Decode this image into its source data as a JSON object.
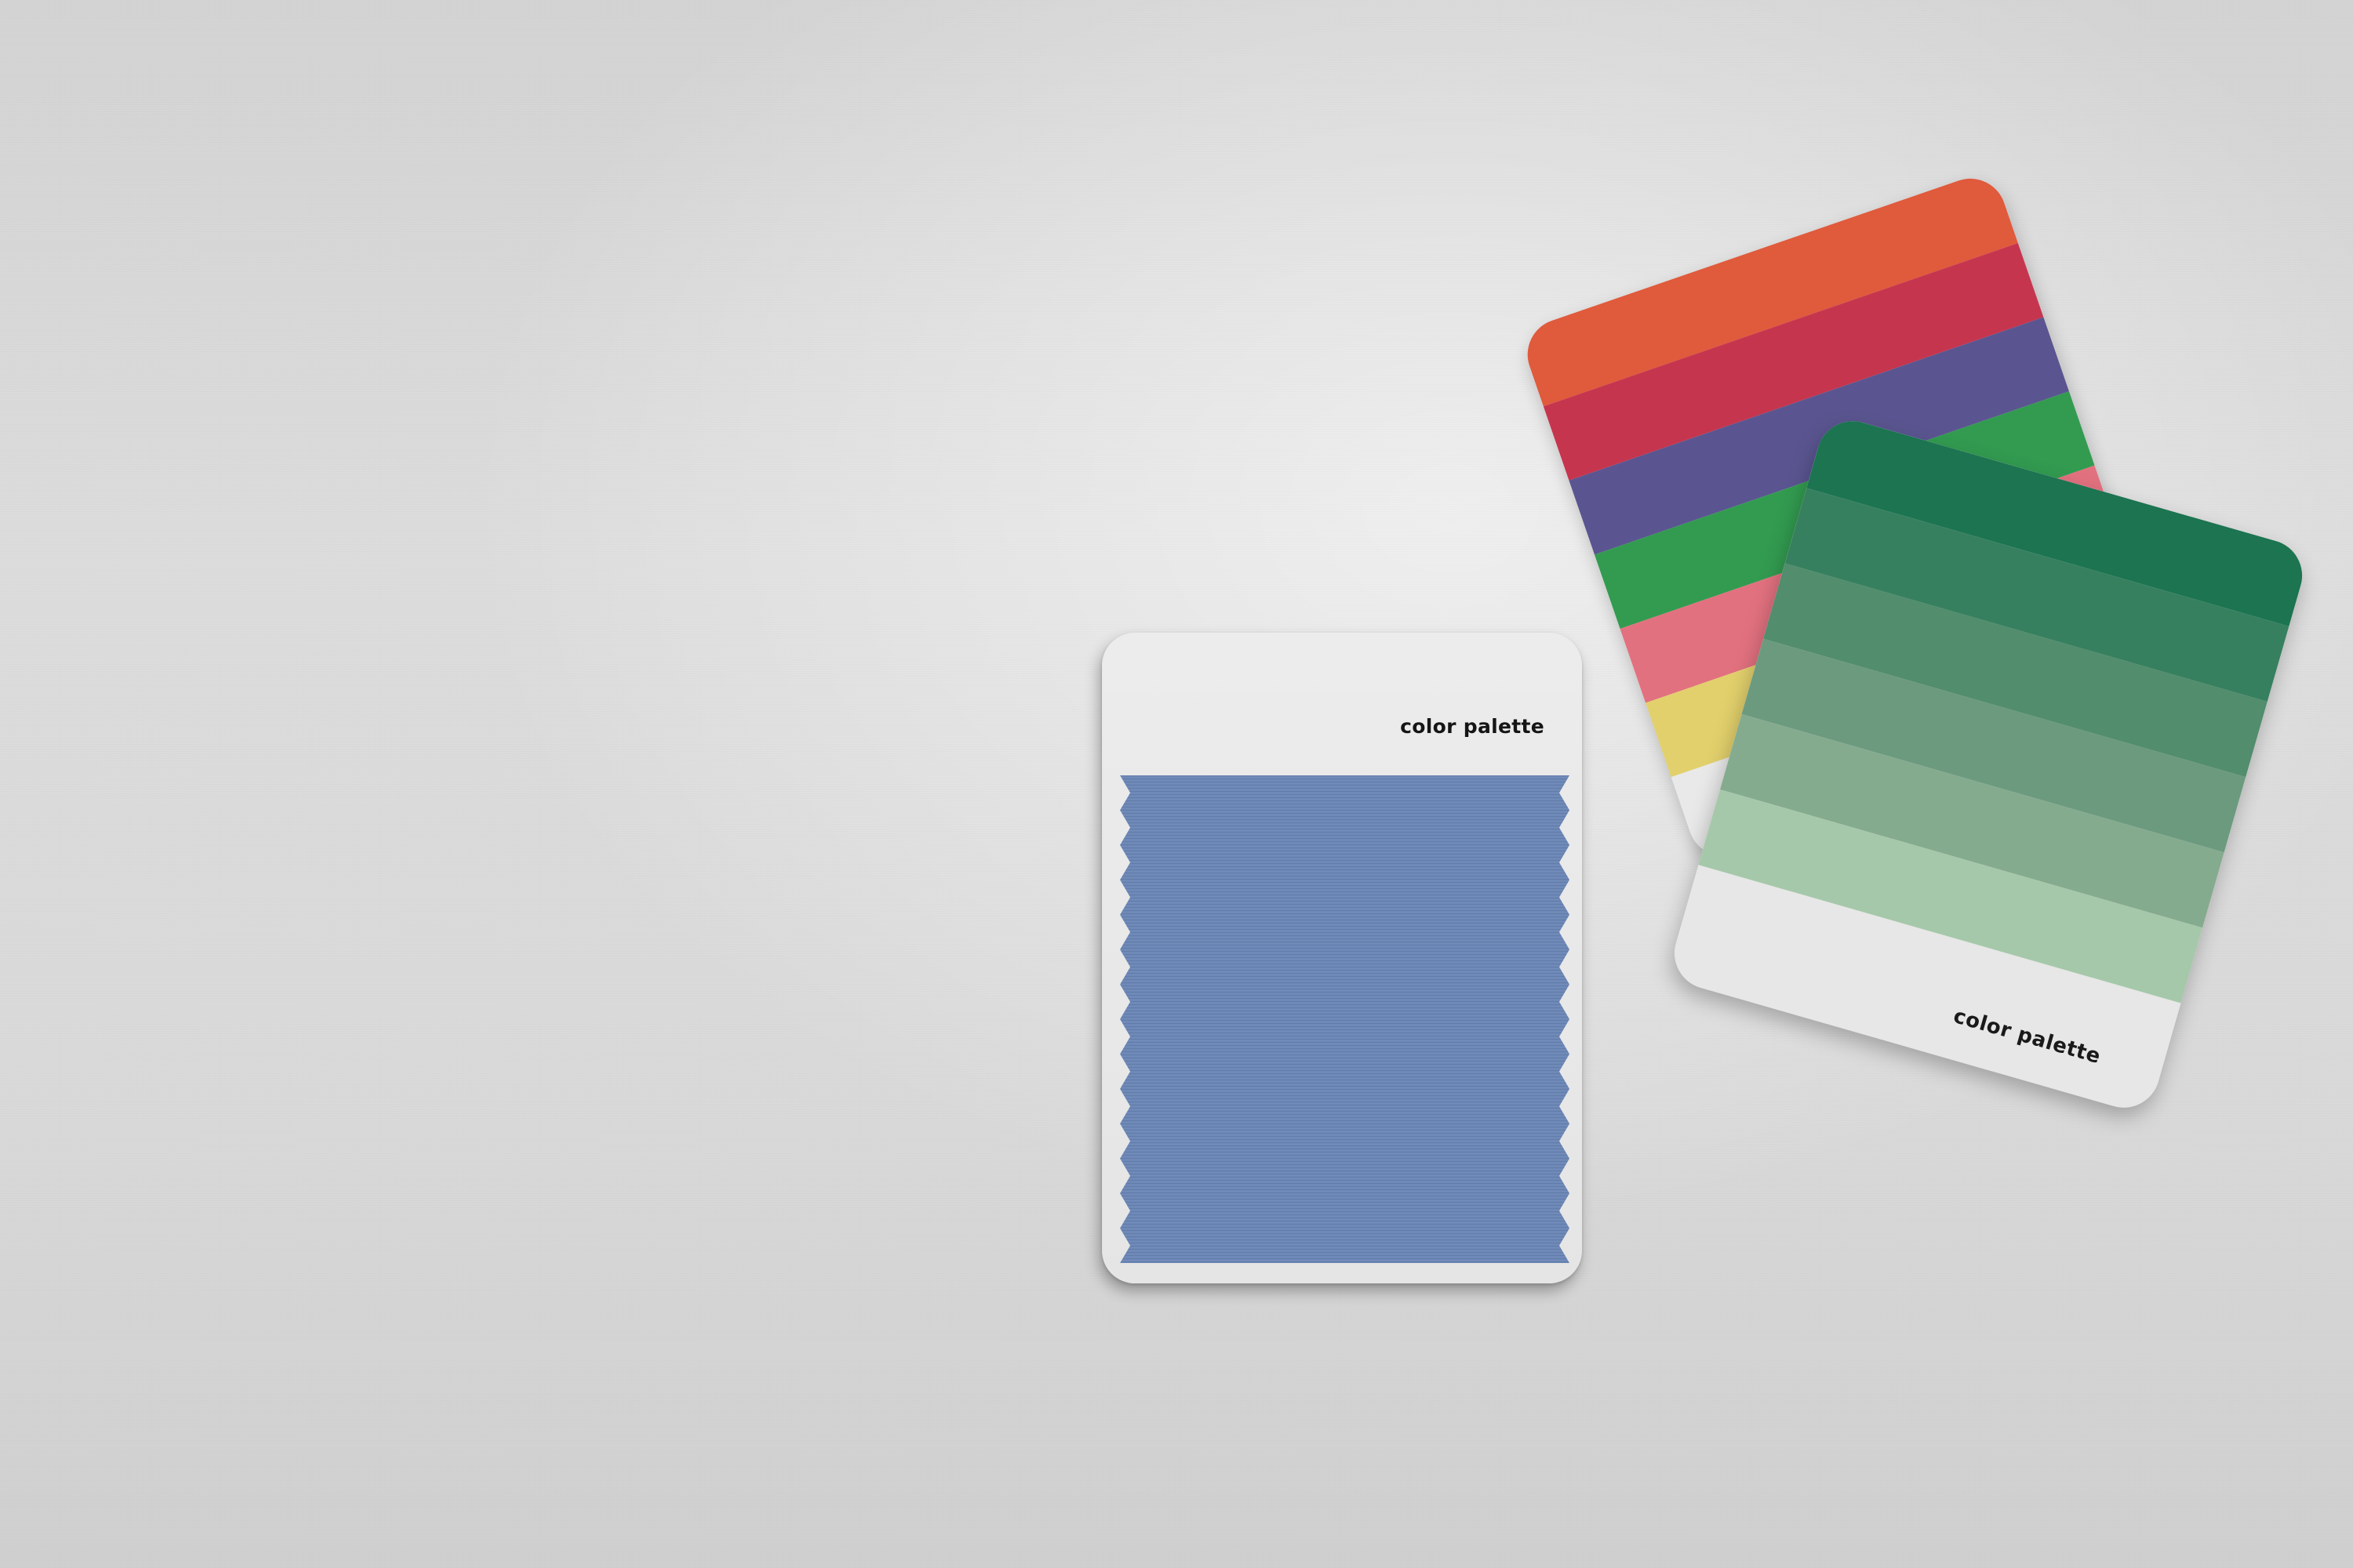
{
  "scene": {
    "background_color": "#d8d8d8"
  },
  "blue_card": {
    "label": "color palette",
    "swatch_color": "#6c87b6",
    "card_color": "#e9e9e9"
  },
  "green_card": {
    "label": "color palette",
    "bands": [
      "#1c7451",
      "#37805f",
      "#528d6d",
      "#6c9a7f",
      "#85ab8f",
      "#a6c8aa"
    ],
    "card_color": "#e7e7e7"
  },
  "multicolor_card": {
    "stripes": [
      "#e05a3c",
      "#c6354e",
      "#5a5590",
      "#329b50",
      "#e2717f",
      "#e2d06c"
    ],
    "card_color": "#e9e9e9"
  }
}
